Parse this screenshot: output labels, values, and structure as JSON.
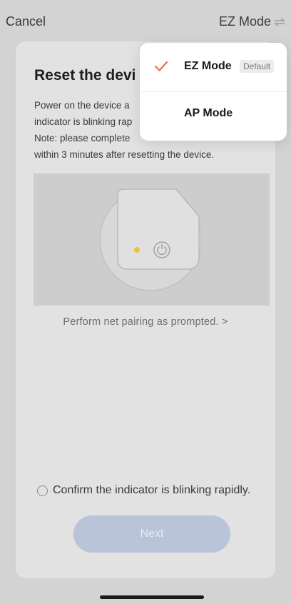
{
  "header": {
    "cancel_label": "Cancel",
    "mode_label": "EZ Mode"
  },
  "card": {
    "title": "Reset the devi",
    "desc_lines": [
      "Power on the device a",
      "indicator is blinking rap",
      "Note: please complete",
      "within 3 minutes after resetting the device."
    ],
    "prompt_link": "Perform net pairing as prompted. >",
    "confirm_label": "Confirm the indicator is blinking rapidly.",
    "next_label": "Next"
  },
  "dropdown": {
    "items": [
      {
        "label": "EZ Mode",
        "badge": "Default",
        "selected": true
      },
      {
        "label": "AP Mode",
        "selected": false
      }
    ]
  },
  "colors": {
    "accent": "#f26b3a",
    "indicator_led": "#e8c437",
    "next_button": "#b9c4d8"
  },
  "icons": {
    "mode_switch": "swap-arrows-icon",
    "selected": "check-icon",
    "power": "power-icon"
  }
}
